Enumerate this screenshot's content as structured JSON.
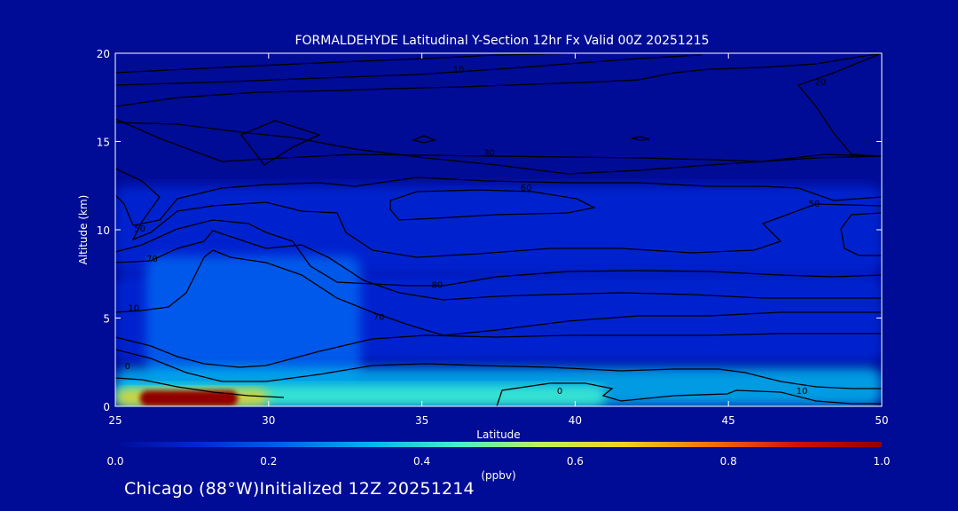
{
  "chart_data": {
    "type": "heatmap",
    "title": "FORMALDEHYDE Latitudinal Y-Section 12hr  Fx Valid 00Z 20251215",
    "xlabel": "Latitude",
    "ylabel": "Altitude (km)",
    "xlim": [
      25,
      50
    ],
    "ylim": [
      0,
      20
    ],
    "xticks": [
      "25",
      "30",
      "35",
      "40",
      "45",
      "50"
    ],
    "yticks": [
      "0",
      "5",
      "10",
      "15",
      "20"
    ],
    "colorbar": {
      "label": "(ppbv)",
      "range": [
        0.0,
        1.0
      ],
      "ticks": [
        "0.0",
        "0.2",
        "0.4",
        "0.6",
        "0.8",
        "1.0"
      ],
      "colors": [
        "#000c96",
        "#0028d8",
        "#0064f0",
        "#00b4f0",
        "#40f0d0",
        "#c0f060",
        "#f0d020",
        "#f07010",
        "#d01010",
        "#900000"
      ]
    },
    "concentration_regions": [
      {
        "lat": [
          25,
          50
        ],
        "alt": [
          7.5,
          12.5
        ],
        "value": 0.08
      },
      {
        "lat": [
          25,
          50
        ],
        "alt": [
          2.5,
          7.5
        ],
        "value": 0.12
      },
      {
        "lat": [
          26,
          33
        ],
        "alt": [
          1.5,
          8.5
        ],
        "value": 0.18
      },
      {
        "lat": [
          25,
          50
        ],
        "alt": [
          0,
          2.2
        ],
        "value": 0.28
      },
      {
        "lat": [
          25,
          41
        ],
        "alt": [
          0,
          1.2
        ],
        "value": 0.42
      },
      {
        "lat": [
          25,
          30
        ],
        "alt": [
          0,
          1.0
        ],
        "value": 0.65
      },
      {
        "lat": [
          25.8,
          29
        ],
        "alt": [
          0,
          0.9
        ],
        "value": 0.95
      }
    ],
    "contour_labels": [
      {
        "text": "10",
        "lat": 36.2,
        "alt": 18.9
      },
      {
        "text": "20",
        "lat": 48.0,
        "alt": 18.2
      },
      {
        "text": "30",
        "lat": 37.2,
        "alt": 14.2
      },
      {
        "text": "60",
        "lat": 38.4,
        "alt": 12.2
      },
      {
        "text": "50",
        "lat": 47.8,
        "alt": 11.3
      },
      {
        "text": "50",
        "lat": 25.8,
        "alt": 9.9
      },
      {
        "text": "70",
        "lat": 26.2,
        "alt": 8.2
      },
      {
        "text": "80",
        "lat": 35.5,
        "alt": 6.7
      },
      {
        "text": "10",
        "lat": 25.6,
        "alt": 5.4
      },
      {
        "text": "70",
        "lat": 33.6,
        "alt": 4.9
      },
      {
        "text": "10",
        "lat": 47.4,
        "alt": 0.7
      },
      {
        "text": "0",
        "lat": 39.5,
        "alt": 0.7
      },
      {
        "text": "0",
        "lat": 25.4,
        "alt": 2.1
      }
    ]
  },
  "footer": {
    "text": "Chicago (88°W)Initialized 12Z 20251214"
  }
}
